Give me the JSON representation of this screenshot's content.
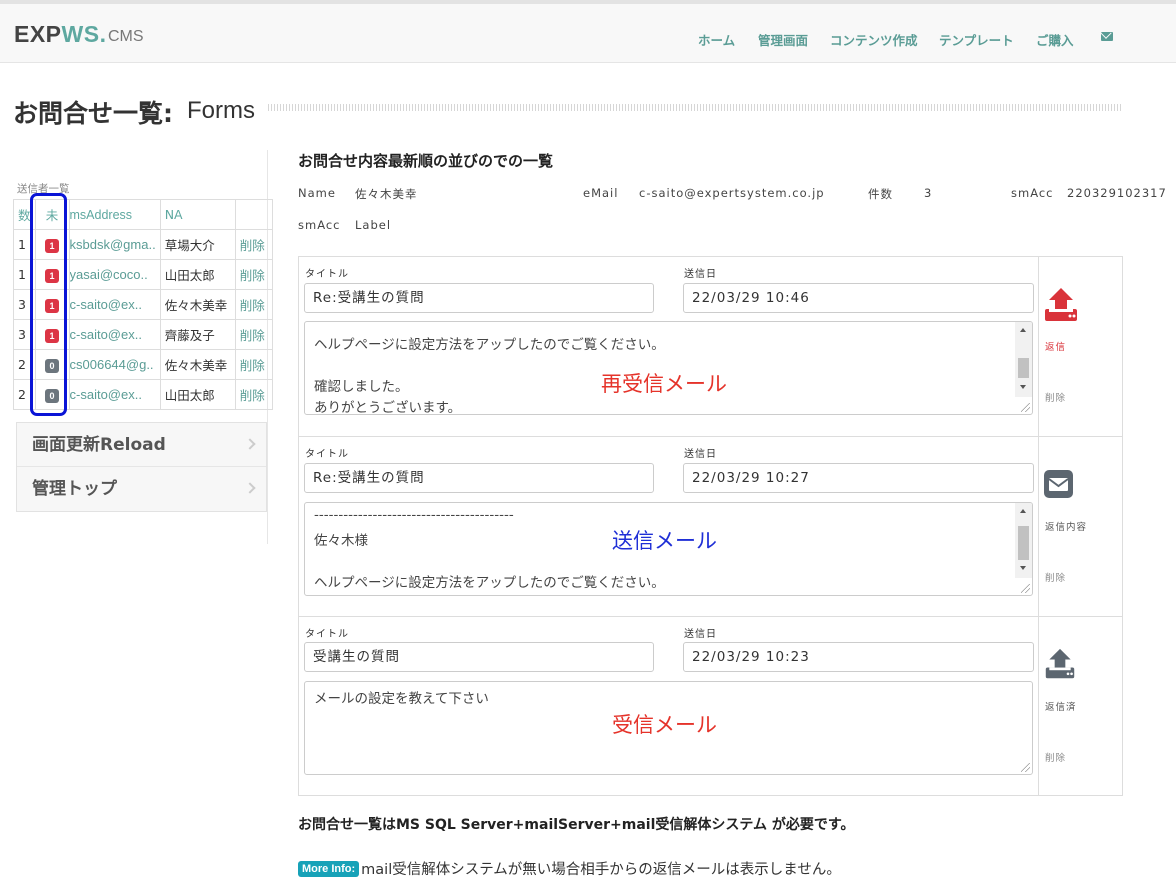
{
  "header": {
    "brand_main": "EXP",
    "brand_accent": "WS.",
    "brand_sub": "CMS",
    "nav": [
      "ホーム",
      "管理画面",
      "コンテンツ作成",
      "テンプレート",
      "ご購入"
    ],
    "nav_icon": "envelope-icon"
  },
  "page": {
    "title": "お問合せ一覧:",
    "subtitle": "Forms"
  },
  "sidebar": {
    "caption": "送信者一覧",
    "columns": [
      "数",
      "未",
      "msAddress",
      "NA",
      ""
    ],
    "rows": [
      {
        "count": "1",
        "unread": "1",
        "unread_color": "red",
        "address": "ksbdsk@gma..",
        "name": "草場大介",
        "action": "削除"
      },
      {
        "count": "1",
        "unread": "1",
        "unread_color": "red",
        "address": "yasai@coco..",
        "name": "山田太郎",
        "action": "削除"
      },
      {
        "count": "3",
        "unread": "1",
        "unread_color": "red",
        "address": "c-saito@ex..",
        "name": "佐々木美幸",
        "action": "削除"
      },
      {
        "count": "3",
        "unread": "1",
        "unread_color": "red",
        "address": "c-saito@ex..",
        "name": "齊藤及子",
        "action": "削除"
      },
      {
        "count": "2",
        "unread": "0",
        "unread_color": "gray",
        "address": "cs006644@g..",
        "name": "佐々木美幸",
        "action": "削除"
      },
      {
        "count": "2",
        "unread": "0",
        "unread_color": "gray",
        "address": "c-saito@ex..",
        "name": "山田太郎",
        "action": "削除"
      }
    ],
    "menu": [
      "画面更新Reload",
      "管理トップ"
    ]
  },
  "main": {
    "heading": "お問合せ内容最新順の並びのでの一覧",
    "meta": {
      "name_label": "Name",
      "name_value": "佐々木美幸",
      "email_label": "eMail",
      "email_value": "c-saito@expertsystem.co.jp",
      "count_label": "件数",
      "count_value": "3",
      "smacc_label": "smAcc",
      "smacc_value": "220329102317",
      "smacc2_label": "smAcc",
      "smacc2_value": "Label"
    },
    "messages": [
      {
        "title_label": "タイトル",
        "title": "Re:受講生の質問",
        "date_label": "送信日",
        "date": "22/03/29 10:46",
        "body": [
          "ヘルプページに設定方法をアップしたのでご覧ください。",
          "",
          "確認しました。",
          "ありがとうございます。"
        ],
        "annotation": "再受信メール",
        "action_icon": "upload-icon",
        "action": "返信",
        "delete": "削除"
      },
      {
        "title_label": "タイトル",
        "title": "Re:受講生の質問",
        "date_label": "送信日",
        "date": "22/03/29 10:27",
        "body": [
          "-----------------------------------------",
          "佐々木様",
          "",
          "ヘルプページに設定方法をアップしたのでご覧ください。"
        ],
        "annotation": "送信メール",
        "action_icon": "envelope-icon",
        "action": "返信内容",
        "delete": "削除"
      },
      {
        "title_label": "タイトル",
        "title": "受講生の質問",
        "date_label": "送信日",
        "date": "22/03/29 10:23",
        "body": [
          "メールの設定を教えて下さい"
        ],
        "annotation": "受信メール",
        "action_icon": "upload-icon",
        "action": "返信済",
        "delete": "削除"
      }
    ]
  },
  "footer": {
    "requirement": "お問合せ一覧はMS SQL Server+mailServer+mail受信解体システム が必要です。",
    "badge": "More Info:",
    "note": "mail受信解体システムが無い場合相手からの返信メールは表示しません。"
  }
}
